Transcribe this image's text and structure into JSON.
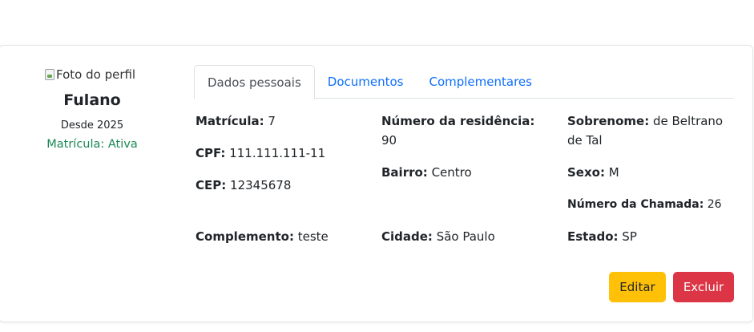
{
  "profile": {
    "photo_alt": "Foto do perfil",
    "name": "Fulano",
    "since": "Desde 2025",
    "status": "Matrícula: Ativa"
  },
  "tabs": [
    {
      "label": "Dados pessoais",
      "active": true
    },
    {
      "label": "Documentos",
      "active": false
    },
    {
      "label": "Complementares",
      "active": false
    }
  ],
  "fields": {
    "matricula": {
      "label": "Matrícula:",
      "value": "7"
    },
    "cpf": {
      "label": "CPF:",
      "value": "111.111.111-11"
    },
    "cep": {
      "label": "CEP:",
      "value": "12345678"
    },
    "complemento": {
      "label": "Complemento:",
      "value": "teste"
    },
    "numero_residencia": {
      "label": "Número da residência:",
      "value": "90"
    },
    "bairro": {
      "label": "Bairro:",
      "value": "Centro"
    },
    "cidade": {
      "label": "Cidade:",
      "value": "São Paulo"
    },
    "sobrenome": {
      "label": "Sobrenome:",
      "value": "de Beltrano de Tal"
    },
    "sexo": {
      "label": "Sexo:",
      "value": "M"
    },
    "numero_chamada": {
      "label": "Número da Chamada:",
      "value": "26"
    },
    "estado": {
      "label": "Estado:",
      "value": "SP"
    }
  },
  "actions": {
    "edit_label": "Editar",
    "delete_label": "Excluir"
  },
  "colors": {
    "status_green": "#198754",
    "link_blue": "#0d6efd",
    "edit_yellow": "#ffc107",
    "delete_red": "#dc3545"
  }
}
